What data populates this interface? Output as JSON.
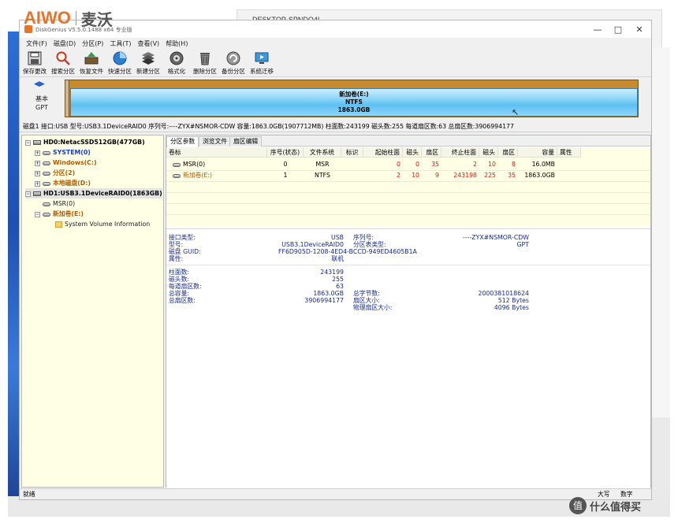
{
  "brand": {
    "logo_text": "AIWO",
    "logo_cn": "麦沃"
  },
  "background_window": {
    "title": "DESKTOP-SPNDO4I"
  },
  "window": {
    "title": "DiskGenius V5.5.0.1488 x64 专业版"
  },
  "menu": [
    "文件(F)",
    "磁盘(D)",
    "分区(P)",
    "工具(T)",
    "查看(V)",
    "帮助(H)"
  ],
  "toolbar": [
    {
      "label": "保存更改",
      "icon": "save-icon"
    },
    {
      "label": "搜索分区",
      "icon": "search-icon"
    },
    {
      "label": "恢复文件",
      "icon": "recover-icon"
    },
    {
      "label": "快速分区",
      "icon": "quick-partition-icon"
    },
    {
      "label": "新建分区",
      "icon": "new-partition-icon"
    },
    {
      "label": "格式化",
      "icon": "format-icon"
    },
    {
      "label": "删除分区",
      "icon": "trash-icon"
    },
    {
      "label": "备份分区",
      "icon": "backup-icon"
    },
    {
      "label": "系统迁移",
      "icon": "migrate-icon"
    }
  ],
  "diskmap": {
    "type_line1": "基本",
    "type_line2": "GPT",
    "partition_name": "新加卷(E:)",
    "partition_fs": "NTFS",
    "partition_size": "1863.0GB"
  },
  "disk_info": "磁盘1 接口:USB  型号:USB3.1DeviceRAID0  序列号:----ZYX#NSMOR-CDW  容量:1863.0GB(1907712MB) 柱面数:243199  磁头数:255  每道扇区数:63  总扇区数:3906994177",
  "tree": [
    {
      "label": "HD0:NetacSSD512GB(477GB)",
      "kind": "disk"
    },
    {
      "label": "SYSTEM(0)",
      "kind": "part-blue"
    },
    {
      "label": "Windows(C:)",
      "kind": "part-orange"
    },
    {
      "label": "分区(2)",
      "kind": "part-orange"
    },
    {
      "label": "本地磁盘(D:)",
      "kind": "part-orange"
    },
    {
      "label": "HD1:USB3.1DeviceRAID0(1863GB)",
      "kind": "disk"
    },
    {
      "label": "MSR(0)",
      "kind": "part-gray"
    },
    {
      "label": "新加卷(E:)",
      "kind": "part-orange"
    },
    {
      "label": "System Volume Information",
      "kind": "folder"
    }
  ],
  "tabs": [
    "分区参数",
    "浏览文件",
    "扇区编辑"
  ],
  "table": {
    "headers": [
      "卷标",
      "序号(状态)",
      "文件系统",
      "标识",
      "起始柱面",
      "磁头",
      "扇区",
      "终止柱面",
      "磁头",
      "扇区",
      "容量",
      "属性"
    ],
    "rows": [
      [
        "MSR(0)",
        "0",
        "MSR",
        "",
        "0",
        "0",
        "35",
        "2",
        "10",
        "8",
        "16.0MB",
        ""
      ],
      [
        "新加卷(E:)",
        "1",
        "NTFS",
        "",
        "2",
        "10",
        "9",
        "243198",
        "225",
        "35",
        "1863.0GB",
        ""
      ]
    ]
  },
  "details": {
    "interface_label": "接口类型:",
    "interface_value": "USB",
    "serial_label": "序列号:",
    "serial_value": "----ZYX#NSMOR-CDW",
    "model_label": "型号:",
    "model_value": "USB3.1DeviceRAID0",
    "pt_label": "分区表类型:",
    "pt_value": "GPT",
    "guid_label": "磁盘 GUID:",
    "guid_value": "FF6D905D-1208-4ED4-BCCD-949ED4605B1A",
    "attr_label": "属性:",
    "attr_value": "联机",
    "cyl_label": "柱面数:",
    "cyl_value": "243199",
    "heads_label": "磁头数:",
    "heads_value": "255",
    "spt_label": "每道扇区数:",
    "spt_value": "63",
    "cap_label": "总容量:",
    "cap_value": "1863.0GB",
    "bytes_label": "总字节数:",
    "bytes_value": "2000381018624",
    "sectors_label": "总扇区数:",
    "sectors_value": "3906994177",
    "secsize_label": "扇区大小:",
    "secsize_value": "512 Bytes",
    "physsec_label": "物理扇区大小:",
    "physsec_value": "4096 Bytes"
  },
  "status": {
    "ready": "就绪",
    "caps": "大写",
    "num": "数字"
  },
  "watermark": {
    "text": "什么值得买",
    "badge": "值"
  }
}
